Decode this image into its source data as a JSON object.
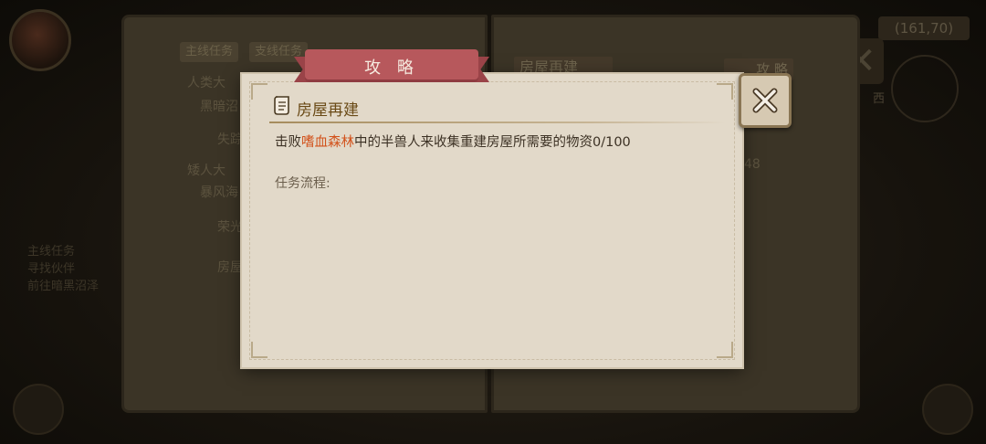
{
  "hud": {
    "coords": "(161,70)",
    "compass_dir": "西",
    "side_lines": [
      "主线任务",
      "寻找伙伴",
      "前往暗黑沼泽"
    ]
  },
  "book": {
    "tabs": [
      "主线任务",
      "支线任务"
    ],
    "tree": [
      {
        "label": "人类大"
      },
      {
        "label": "黑暗沼"
      },
      {
        "label": "失踪"
      },
      {
        "label": "矮人大"
      },
      {
        "label": "暴风海"
      },
      {
        "label": "荣光"
      },
      {
        "label": "房屋"
      }
    ],
    "right_title": "房屋再建",
    "right_guide": "攻 略",
    "right_number": "48"
  },
  "dialog": {
    "title": "攻 略",
    "section_title": "房屋再建",
    "desc_prefix": "击败",
    "desc_highlight": "嗜血森林",
    "desc_suffix": "中的半兽人来收集重建房屋所需要的物资0/100",
    "flow_label": "任务流程:",
    "colors": {
      "highlight": "#d2511a",
      "ribbon": "#b7585c",
      "title": "#6a4a16"
    }
  },
  "icons": {
    "close": "close-icon",
    "scroll": "scroll-icon"
  }
}
